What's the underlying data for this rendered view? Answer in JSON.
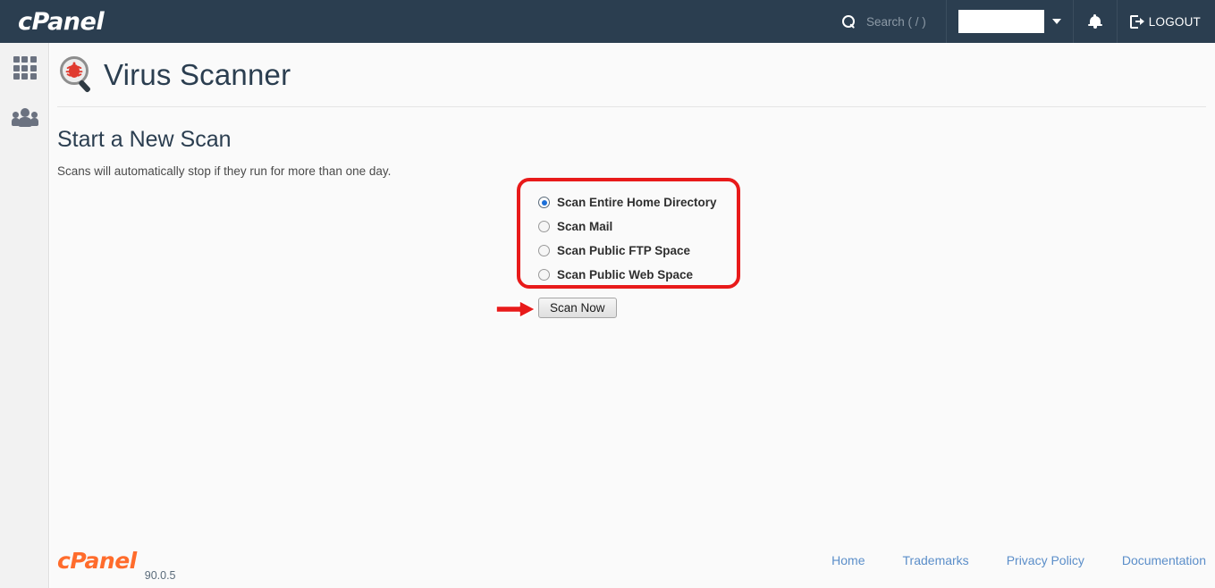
{
  "header": {
    "brand": "cPanel",
    "search": {
      "placeholder": "Search ( / )",
      "icon": "search-icon",
      "value": ""
    },
    "user": {
      "name": "",
      "caret_icon": "chevron-down-icon"
    },
    "notifications_icon": "bell-icon",
    "logout": {
      "label": "LOGOUT",
      "icon": "logout-icon"
    }
  },
  "sidebar": {
    "items": [
      {
        "name": "apps-grid",
        "icon": "grid-icon"
      },
      {
        "name": "user-manager",
        "icon": "people-icon"
      }
    ]
  },
  "page": {
    "icon": "virus-scanner-icon",
    "title": "Virus Scanner",
    "section_title": "Start a New Scan",
    "description": "Scans will automatically stop if they run for more than one day."
  },
  "scan_options": [
    {
      "label": "Scan Entire Home Directory",
      "checked": true
    },
    {
      "label": "Scan Mail",
      "checked": false
    },
    {
      "label": "Scan Public FTP Space",
      "checked": false
    },
    {
      "label": "Scan Public Web Space",
      "checked": false
    }
  ],
  "actions": {
    "scan_now": "Scan Now"
  },
  "annotations": {
    "color": "#e81a1a",
    "box_target": "scan-options-group",
    "arrow_target": "scan-now-button"
  },
  "footer": {
    "logo": "cPanel",
    "version": "90.0.5",
    "links": [
      "Home",
      "Trademarks",
      "Privacy Policy",
      "Documentation"
    ]
  },
  "colors": {
    "header_bg": "#2b3e50",
    "sidebar_bg": "#f2f2f2",
    "content_bg": "#fafafa",
    "title_text": "#2b3e50",
    "link": "#5b8ec9",
    "logo_orange": "#ff6c2c",
    "radio_accent": "#1c6fd8"
  }
}
